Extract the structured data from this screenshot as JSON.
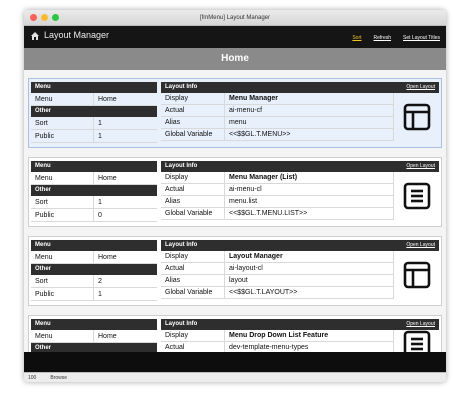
{
  "window": {
    "title": "[fmMenu] Layout Manager"
  },
  "app": {
    "title": "Layout Manager",
    "links": [
      "Sort",
      "Refresh",
      "Set Layout Titles"
    ]
  },
  "page": {
    "heading": "Home"
  },
  "labels": {
    "menu": "Menu",
    "other": "Other",
    "sort": "Sort",
    "public": "Public",
    "layout_info": "Layout Info",
    "open_layout": "Open Layout",
    "display": "Display",
    "actual": "Actual",
    "alias": "Alias",
    "global_variable": "Global Variable"
  },
  "records": [
    {
      "menu": "Home",
      "sort": "1",
      "public": "1",
      "display": "Menu Manager",
      "actual": "ai-menu-cf",
      "alias": "menu",
      "global": "<<$$GL.T.MENU>>",
      "icon": "layout-icon"
    },
    {
      "menu": "Home",
      "sort": "1",
      "public": "0",
      "display": "Menu Manager (List)",
      "actual": "ai-menu-cl",
      "alias": "menu.list",
      "global": "<<$$GL.T.MENU.LIST>>",
      "icon": "list-icon"
    },
    {
      "menu": "Home",
      "sort": "2",
      "public": "1",
      "display": "Layout Manager",
      "actual": "ai-layout-cl",
      "alias": "layout",
      "global": "<<$$GL.T.LAYOUT>>",
      "icon": "layout-icon"
    },
    {
      "menu": "Home",
      "sort": "",
      "public": "",
      "display": "Menu Drop Down List Feature",
      "actual": "dev-template-menu-types",
      "alias": "",
      "global": "",
      "icon": "list-icon"
    }
  ],
  "status": {
    "zoom": "100",
    "mode": "Browse"
  }
}
